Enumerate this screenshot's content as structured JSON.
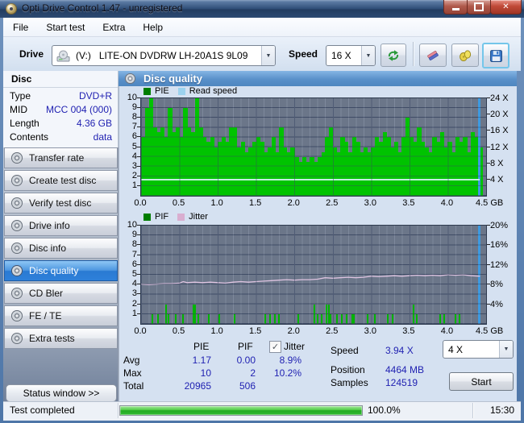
{
  "window": {
    "title": "Opti Drive Control 1.47 - unregistered",
    "icons": {
      "app": "disc-icon",
      "minimize": "minimize-icon",
      "maximize": "maximize-icon",
      "close": "close-icon"
    },
    "close_glyph": "✕"
  },
  "menu": {
    "items": [
      "File",
      "Start test",
      "Extra",
      "Help"
    ]
  },
  "toolbar": {
    "drive_label": "Drive",
    "drive_value": "(V:)   LITE-ON DVDRW LH-20A1S 9L09",
    "speed_label": "Speed",
    "speed_value": "16 X",
    "icons": {
      "refresh": "refresh-icon",
      "erase": "eraser-icon",
      "tools": "disc-tools-icon",
      "save": "save-floppy-icon"
    },
    "dropdown_arrow": "▼"
  },
  "sidebar": {
    "disc_header": "Disc",
    "info": [
      {
        "label": "Type",
        "value": "DVD+R"
      },
      {
        "label": "MID",
        "value": "MCC 004 (000)"
      },
      {
        "label": "Length",
        "value": "4.36 GB"
      },
      {
        "label": "Contents",
        "value": "data"
      }
    ],
    "buttons": [
      {
        "label": "Transfer rate",
        "selected": false
      },
      {
        "label": "Create test disc",
        "selected": false
      },
      {
        "label": "Verify test disc",
        "selected": false
      },
      {
        "label": "Drive info",
        "selected": false
      },
      {
        "label": "Disc info",
        "selected": false
      },
      {
        "label": "Disc quality",
        "selected": true
      },
      {
        "label": "CD Bler",
        "selected": false
      },
      {
        "label": "FE / TE",
        "selected": false
      },
      {
        "label": "Extra tests",
        "selected": false
      }
    ],
    "status_window_label": "Status window >>"
  },
  "panel": {
    "title": "Disc quality"
  },
  "chart_data": [
    {
      "type": "bar",
      "title": "PIE / Read speed",
      "legend": [
        "PIE",
        "Read speed"
      ],
      "legend_colors": [
        "#007d00",
        "#9cd2ee"
      ],
      "x_ticks": [
        "0.0",
        "0.5",
        "1.0",
        "1.5",
        "2.0",
        "2.5",
        "3.0",
        "3.5",
        "4.0",
        "4.5"
      ],
      "x_unit": "GB",
      "xlim": [
        0,
        4.5
      ],
      "ylim": [
        0,
        10
      ],
      "y_ticks": [
        1,
        2,
        3,
        4,
        5,
        6,
        7,
        8,
        9,
        10
      ],
      "right_axis_labels": [
        {
          "label": "24 X",
          "units": 10
        },
        {
          "label": "20 X",
          "units": 8.33
        },
        {
          "label": "16 X",
          "units": 6.67
        },
        {
          "label": "12 X",
          "units": 5
        },
        {
          "label": "8 X",
          "units": 3.33
        },
        {
          "label": "4 X",
          "units": 1.67
        }
      ],
      "bar_color": "#00c300",
      "x_start": 0,
      "x_step": 0.05,
      "values": [
        6,
        9,
        10,
        7,
        6.5,
        7,
        6,
        9,
        6.5,
        7,
        6,
        9,
        7,
        6.5,
        10,
        7,
        6,
        5.5,
        6,
        5,
        5.5,
        6,
        5.5,
        7,
        7,
        5,
        5.5,
        4.5,
        5,
        5.5,
        6,
        5.5,
        4.5,
        5,
        6,
        4.5,
        7,
        5,
        4.5,
        5,
        4,
        3.5,
        4,
        3.5,
        4,
        3.5,
        4,
        4.5,
        6,
        7,
        5,
        4.5,
        6,
        5.5,
        4.5,
        6,
        5.5,
        4.5,
        5,
        4.5,
        5,
        6,
        5.5,
        6.5,
        6,
        5,
        5.5,
        4.5,
        6,
        8,
        6,
        5.5,
        7,
        5.5,
        5,
        4.5,
        6,
        5.5,
        6.5,
        5,
        5.5,
        4.5,
        6,
        5.5,
        6,
        4.5,
        6.5,
        6,
        5
      ],
      "read_speed_line": {
        "y_units": 1.64,
        "x_end": 4.42,
        "color": "#c2efe0",
        "avg_speed": "3.94 X"
      },
      "end_marker": {
        "x": 4.41,
        "color": "#3d9ae1"
      }
    },
    {
      "type": "line",
      "title": "PIF / Jitter",
      "legend": [
        "PIF",
        "Jitter"
      ],
      "legend_colors": [
        "#007d00",
        "#d9aed0"
      ],
      "x_ticks": [
        "0.0",
        "0.5",
        "1.0",
        "1.5",
        "2.0",
        "2.5",
        "3.0",
        "3.5",
        "4.0",
        "4.5"
      ],
      "x_unit": "GB",
      "xlim": [
        0,
        4.5
      ],
      "ylim": [
        0,
        10
      ],
      "y_ticks": [
        1,
        2,
        3,
        4,
        5,
        6,
        7,
        8,
        9,
        10
      ],
      "right_axis_labels": [
        {
          "label": "20%",
          "units": 10
        },
        {
          "label": "16%",
          "units": 8
        },
        {
          "label": "12%",
          "units": 6
        },
        {
          "label": "8%",
          "units": 4
        },
        {
          "label": "4%",
          "units": 2
        }
      ],
      "pif_color": "#00b400",
      "pif_spikes": [
        [
          0.15,
          1
        ],
        [
          0.22,
          1
        ],
        [
          0.33,
          2
        ],
        [
          0.36,
          1
        ],
        [
          0.45,
          1
        ],
        [
          0.55,
          1
        ],
        [
          0.68,
          2
        ],
        [
          0.7,
          2
        ],
        [
          0.75,
          1
        ],
        [
          0.88,
          1
        ],
        [
          1.02,
          1
        ],
        [
          1.22,
          1
        ],
        [
          1.62,
          1
        ],
        [
          1.68,
          1
        ],
        [
          1.75,
          1
        ],
        [
          1.8,
          1
        ],
        [
          2.05,
          1
        ],
        [
          2.26,
          2
        ],
        [
          2.3,
          1
        ],
        [
          2.35,
          1
        ],
        [
          2.42,
          2
        ],
        [
          2.45,
          2
        ],
        [
          2.47,
          1
        ],
        [
          2.55,
          1
        ],
        [
          2.62,
          1
        ],
        [
          2.68,
          1
        ],
        [
          2.75,
          1
        ],
        [
          2.78,
          1
        ],
        [
          2.95,
          1
        ],
        [
          3.05,
          1
        ],
        [
          3.22,
          1
        ],
        [
          3.28,
          1
        ],
        [
          3.55,
          2
        ],
        [
          3.6,
          1
        ],
        [
          3.9,
          1
        ],
        [
          3.95,
          1
        ],
        [
          4.1,
          1
        ],
        [
          4.15,
          1
        ]
      ],
      "jitter_color": "#ddc3e0",
      "jitter_points": [
        [
          0,
          4.05
        ],
        [
          0.1,
          4.0
        ],
        [
          0.2,
          4.05
        ],
        [
          0.3,
          4.1
        ],
        [
          0.4,
          4.1
        ],
        [
          0.5,
          4.15
        ],
        [
          0.55,
          4.3
        ],
        [
          0.6,
          4.2
        ],
        [
          0.7,
          4.25
        ],
        [
          0.8,
          4.2
        ],
        [
          0.9,
          4.25
        ],
        [
          1.0,
          4.2
        ],
        [
          1.1,
          4.15
        ],
        [
          1.2,
          4.25
        ],
        [
          1.3,
          4.3
        ],
        [
          1.4,
          4.25
        ],
        [
          1.5,
          4.3
        ],
        [
          1.6,
          4.35
        ],
        [
          1.7,
          4.4
        ],
        [
          1.8,
          4.45
        ],
        [
          1.9,
          4.5
        ],
        [
          2.0,
          4.45
        ],
        [
          2.1,
          4.5
        ],
        [
          2.2,
          4.5
        ],
        [
          2.3,
          4.55
        ],
        [
          2.4,
          4.7
        ],
        [
          2.5,
          4.65
        ],
        [
          2.6,
          4.7
        ],
        [
          2.7,
          4.75
        ],
        [
          2.8,
          4.7
        ],
        [
          2.9,
          4.75
        ],
        [
          3.0,
          4.85
        ],
        [
          3.1,
          4.8
        ],
        [
          3.2,
          4.85
        ],
        [
          3.3,
          4.9
        ],
        [
          3.4,
          4.85
        ],
        [
          3.5,
          4.9
        ],
        [
          3.6,
          4.95
        ],
        [
          3.7,
          4.9
        ],
        [
          3.8,
          4.95
        ],
        [
          3.9,
          4.9
        ],
        [
          4.0,
          5.0
        ],
        [
          4.1,
          4.95
        ],
        [
          4.2,
          5.0
        ],
        [
          4.3,
          4.9
        ],
        [
          4.42,
          4.85
        ]
      ],
      "end_marker": {
        "x": 4.41,
        "color": "#3d9ae1"
      }
    }
  ],
  "stats": {
    "col_headers": {
      "pie": "PIE",
      "pif": "PIF",
      "jitter": "Jitter"
    },
    "jitter_checked": true,
    "check_glyph": "✓",
    "rows": [
      {
        "label": "Avg",
        "pie": "1.17",
        "pif": "0.00",
        "jitter": "8.9%"
      },
      {
        "label": "Max",
        "pie": "10",
        "pif": "2",
        "jitter": "10.2%"
      },
      {
        "label": "Total",
        "pie": "20965",
        "pif": "506",
        "jitter": ""
      }
    ],
    "right": [
      {
        "label": "Speed",
        "value": "3.94 X"
      },
      {
        "label": "Position",
        "value": "4464 MB"
      },
      {
        "label": "Samples",
        "value": "124519"
      }
    ],
    "speed_select": "4 X",
    "start_label": "Start"
  },
  "statusbar": {
    "text": "Test completed",
    "progress_label": "100.0%",
    "progress_value": 100,
    "time": "15:30"
  }
}
